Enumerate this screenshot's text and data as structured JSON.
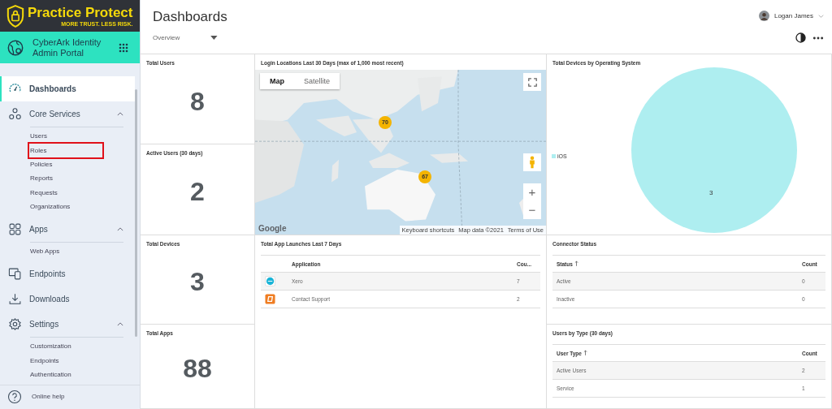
{
  "brand": {
    "name": "Practice Protect",
    "tagline": "MORE TRUST. LESS RISK."
  },
  "portal": {
    "title": "CyberArk Identity Admin Portal"
  },
  "nav": [
    {
      "label": "Dashboards",
      "kind": "link",
      "selected": true
    },
    {
      "label": "Core Services",
      "kind": "group",
      "selected": false,
      "expanded": true,
      "children": [
        {
          "label": "Users",
          "selected": false,
          "highlighted": false
        },
        {
          "label": "Roles",
          "selected": false,
          "highlighted": true
        },
        {
          "label": "Policies",
          "selected": false,
          "highlighted": false
        },
        {
          "label": "Reports",
          "selected": false,
          "highlighted": false
        },
        {
          "label": "Requests",
          "selected": false,
          "highlighted": false
        },
        {
          "label": "Organizations",
          "selected": false,
          "highlighted": false
        }
      ]
    },
    {
      "label": "Apps",
      "kind": "group",
      "selected": false,
      "expanded": true,
      "children": [
        {
          "label": "Web Apps",
          "selected": false,
          "highlighted": false
        }
      ]
    },
    {
      "label": "Endpoints",
      "kind": "link",
      "selected": false
    },
    {
      "label": "Downloads",
      "kind": "link",
      "selected": false
    },
    {
      "label": "Settings",
      "kind": "group",
      "selected": false,
      "expanded": true,
      "children": [
        {
          "label": "Customization",
          "selected": false,
          "highlighted": false
        },
        {
          "label": "Endpoints",
          "selected": false,
          "highlighted": false
        },
        {
          "label": "Authentication",
          "selected": false,
          "highlighted": false
        }
      ]
    }
  ],
  "help": {
    "label": "Online help"
  },
  "header": {
    "title": "Dashboards",
    "view": "Overview",
    "user": "Logan James"
  },
  "stats": [
    {
      "title": "Total Users",
      "value": "8"
    },
    {
      "title": "Active Users (30 days)",
      "value": "2"
    },
    {
      "title": "Total Devices",
      "value": "3"
    },
    {
      "title": "Total Apps",
      "value": "88"
    }
  ],
  "map": {
    "title": "Login Locations Last 30 Days (max of 1,000 most recent)",
    "tabs": [
      {
        "label": "Map",
        "selected": true
      },
      {
        "label": "Satellite",
        "selected": false
      }
    ],
    "clusters": [
      {
        "count": "70"
      },
      {
        "count": "67"
      }
    ],
    "zoom_in": "+",
    "zoom_out": "−",
    "logo": "Google",
    "attribution": [
      "Keyboard shortcuts",
      "Map data ©2021",
      "Terms of Use"
    ]
  },
  "os_chart": {
    "title": "Total Devices by Operating System",
    "chart_data": {
      "type": "pie",
      "categories": [
        "iOS"
      ],
      "series": [
        {
          "color": "#aeeef0",
          "values": [
            3
          ]
        }
      ],
      "data_labels": true
    }
  },
  "launches": {
    "title": "Total App Launches Last 7 Days",
    "columns": [
      "Application",
      "Cou..."
    ],
    "rows": [
      {
        "name": "Xero",
        "count": "7"
      },
      {
        "name": "Contact Support",
        "count": "2"
      }
    ]
  },
  "connectors": {
    "title": "Connector Status",
    "columns": [
      "Status",
      "Count"
    ],
    "rows": [
      {
        "name": "Active",
        "count": "0"
      },
      {
        "name": "Inactive",
        "count": "0"
      }
    ]
  },
  "user_types": {
    "title": "Users by Type (30 days)",
    "columns": [
      "User Type",
      "Count"
    ],
    "rows": [
      {
        "name": "Active Users",
        "count": "2"
      },
      {
        "name": "Service",
        "count": "1"
      }
    ]
  }
}
